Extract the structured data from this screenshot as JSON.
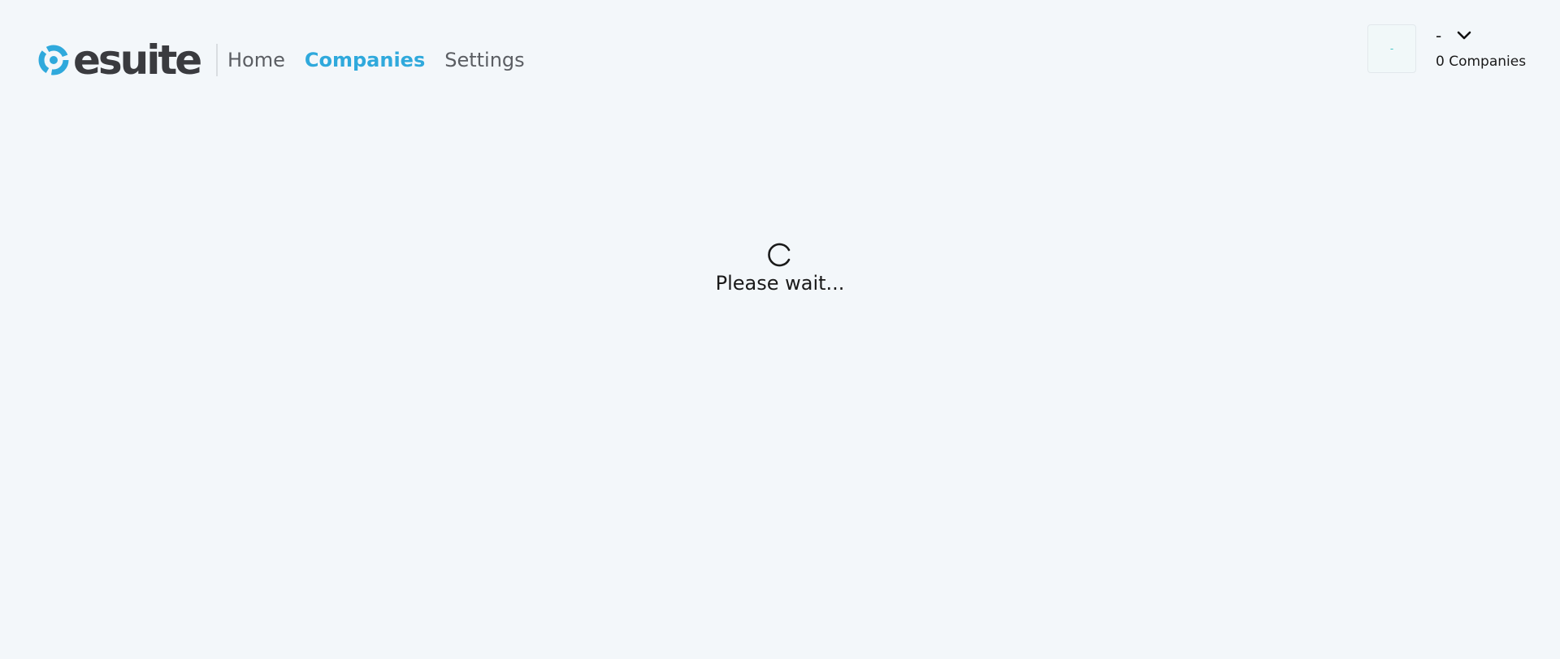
{
  "app": {
    "logo_text": "esuite",
    "brand_color": "#2fa9dc"
  },
  "nav": {
    "items": [
      {
        "label": "Home",
        "active": false
      },
      {
        "label": "Companies",
        "active": true
      },
      {
        "label": "Settings",
        "active": false
      }
    ]
  },
  "user": {
    "avatar_text": "-",
    "name": "-",
    "companies_count": "0 Companies",
    "dropdown_icon": "chevron-down-icon"
  },
  "loading": {
    "icon": "spinner-icon",
    "message": "Please wait..."
  }
}
